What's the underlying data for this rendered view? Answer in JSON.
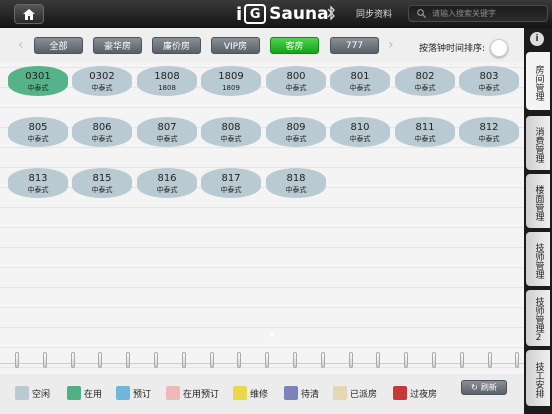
{
  "header": {
    "logo_i": "i",
    "logo_box": "G",
    "logo_text": "Sauna",
    "sync_label": "同步资料",
    "search_placeholder": "请输入搜索关键字"
  },
  "filters": {
    "tabs": [
      {
        "label": "全部",
        "active": false
      },
      {
        "label": "豪华房",
        "active": false
      },
      {
        "label": "廉价房",
        "active": false
      },
      {
        "label": "VIP房",
        "active": false
      },
      {
        "label": "客房",
        "active": true
      },
      {
        "label": "777",
        "active": false
      }
    ],
    "sort_label": "按落钟时间排序:"
  },
  "rooms": [
    {
      "num": "0301",
      "type": "中泰式",
      "status": "在用"
    },
    {
      "num": "0302",
      "type": "中泰式",
      "status": "空闲"
    },
    {
      "num": "1808",
      "type": "1808",
      "status": "空闲"
    },
    {
      "num": "1809",
      "type": "1809",
      "status": "空闲"
    },
    {
      "num": "800",
      "type": "中泰式",
      "status": "空闲"
    },
    {
      "num": "801",
      "type": "中泰式",
      "status": "空闲"
    },
    {
      "num": "802",
      "type": "中泰式",
      "status": "空闲"
    },
    {
      "num": "803",
      "type": "中泰式",
      "status": "空闲"
    },
    {
      "num": "805",
      "type": "中泰式",
      "status": "空闲"
    },
    {
      "num": "806",
      "type": "中泰式",
      "status": "空闲"
    },
    {
      "num": "807",
      "type": "中泰式",
      "status": "空闲"
    },
    {
      "num": "808",
      "type": "中泰式",
      "status": "空闲"
    },
    {
      "num": "809",
      "type": "中泰式",
      "status": "空闲"
    },
    {
      "num": "810",
      "type": "中泰式",
      "status": "空闲"
    },
    {
      "num": "811",
      "type": "中泰式",
      "status": "空闲"
    },
    {
      "num": "812",
      "type": "中泰式",
      "status": "空闲"
    },
    {
      "num": "813",
      "type": "中泰式",
      "status": "空闲"
    },
    {
      "num": "815",
      "type": "中泰式",
      "status": "空闲"
    },
    {
      "num": "816",
      "type": "中泰式",
      "status": "空闲"
    },
    {
      "num": "817",
      "type": "中泰式",
      "status": "空闲"
    },
    {
      "num": "818",
      "type": "中泰式",
      "status": "空闲"
    }
  ],
  "legend": [
    {
      "label": "空闲",
      "color": "#b9cad3"
    },
    {
      "label": "在用",
      "color": "#4faf85"
    },
    {
      "label": "预订",
      "color": "#6db8d6"
    },
    {
      "label": "在用预订",
      "color": "#f0b9b9"
    },
    {
      "label": "维修",
      "color": "#ecd94a"
    },
    {
      "label": "待清",
      "color": "#7e82ba"
    },
    {
      "label": "已派房",
      "color": "#e6d7b4"
    },
    {
      "label": "过夜房",
      "color": "#c73838"
    }
  ],
  "refresh_label": "刷新",
  "sidebar": {
    "info": "i",
    "tabs": [
      {
        "label": "房间管理",
        "active": true
      },
      {
        "label": "消费管理",
        "active": false
      },
      {
        "label": "楼面管理",
        "active": false
      },
      {
        "label": "技师管理",
        "active": false
      },
      {
        "label": "技师管理2",
        "active": false
      },
      {
        "label": "技工安排",
        "active": false
      }
    ]
  }
}
